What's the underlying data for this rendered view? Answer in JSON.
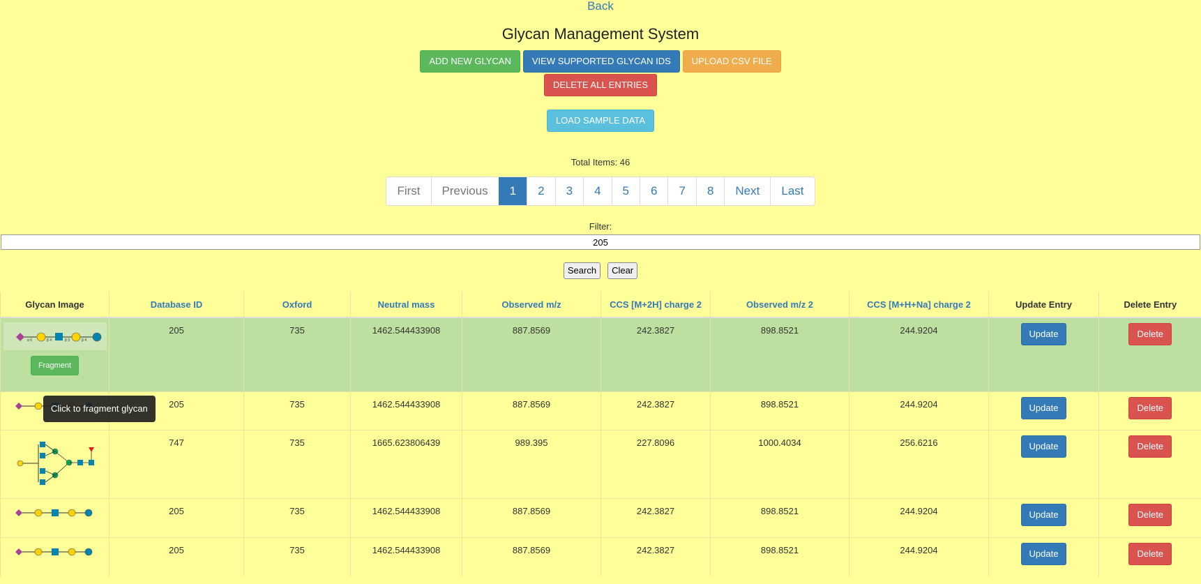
{
  "nav": {
    "back_label": "Back"
  },
  "title": "Glycan Management System",
  "toolbar": {
    "add_label": "ADD NEW GLYCAN",
    "view_label": "VIEW SUPPORTED GLYCAN IDS",
    "upload_label": "UPLOAD CSV FILE",
    "delete_all_label": "DELETE ALL ENTRIES",
    "load_sample_label": "LOAD SAMPLE DATA"
  },
  "total_items": "Total Items: 46",
  "pagination": {
    "first": "First",
    "previous": "Previous",
    "pages": [
      "1",
      "2",
      "3",
      "4",
      "5",
      "6",
      "7",
      "8"
    ],
    "active": "1",
    "next": "Next",
    "last": "Last"
  },
  "filter": {
    "label": "Filter:",
    "value": "205"
  },
  "search_buttons": {
    "search": "Search",
    "clear": "Clear"
  },
  "table": {
    "headers": [
      "Glycan Image",
      "Database ID",
      "Oxford",
      "Neutral mass",
      "Observed m/z",
      "CCS [M+2H] charge 2",
      "Observed m/z 2",
      "CCS [M+H+Na] charge 2",
      "Update Entry",
      "Delete Entry"
    ],
    "rows": [
      [
        "205",
        "735",
        "1462.544433908",
        "887.8569",
        "242.3827",
        "898.8521",
        "244.9204"
      ],
      [
        "205",
        "735",
        "1462.544433908",
        "887.8569",
        "242.3827",
        "898.8521",
        "244.9204"
      ],
      [
        "747",
        "735",
        "1665.623806439",
        "989.395",
        "227.8096",
        "1000.4034",
        "256.6216"
      ],
      [
        "205",
        "735",
        "1462.544433908",
        "887.8569",
        "242.3827",
        "898.8521",
        "244.9204"
      ],
      [
        "205",
        "735",
        "1462.544433908",
        "887.8569",
        "242.3827",
        "898.8521",
        "244.9204"
      ]
    ],
    "update_label": "Update",
    "delete_label": "Delete",
    "fragment_label": "Fragment"
  },
  "tooltip": "Click to fragment glycan",
  "colors": {
    "background": "#ffff99",
    "highlight_row": "#bddf9f",
    "primary": "#337ab7",
    "success": "#5cb85c",
    "warning": "#f0ad4e",
    "danger": "#d9534f",
    "info": "#5bc0de"
  }
}
